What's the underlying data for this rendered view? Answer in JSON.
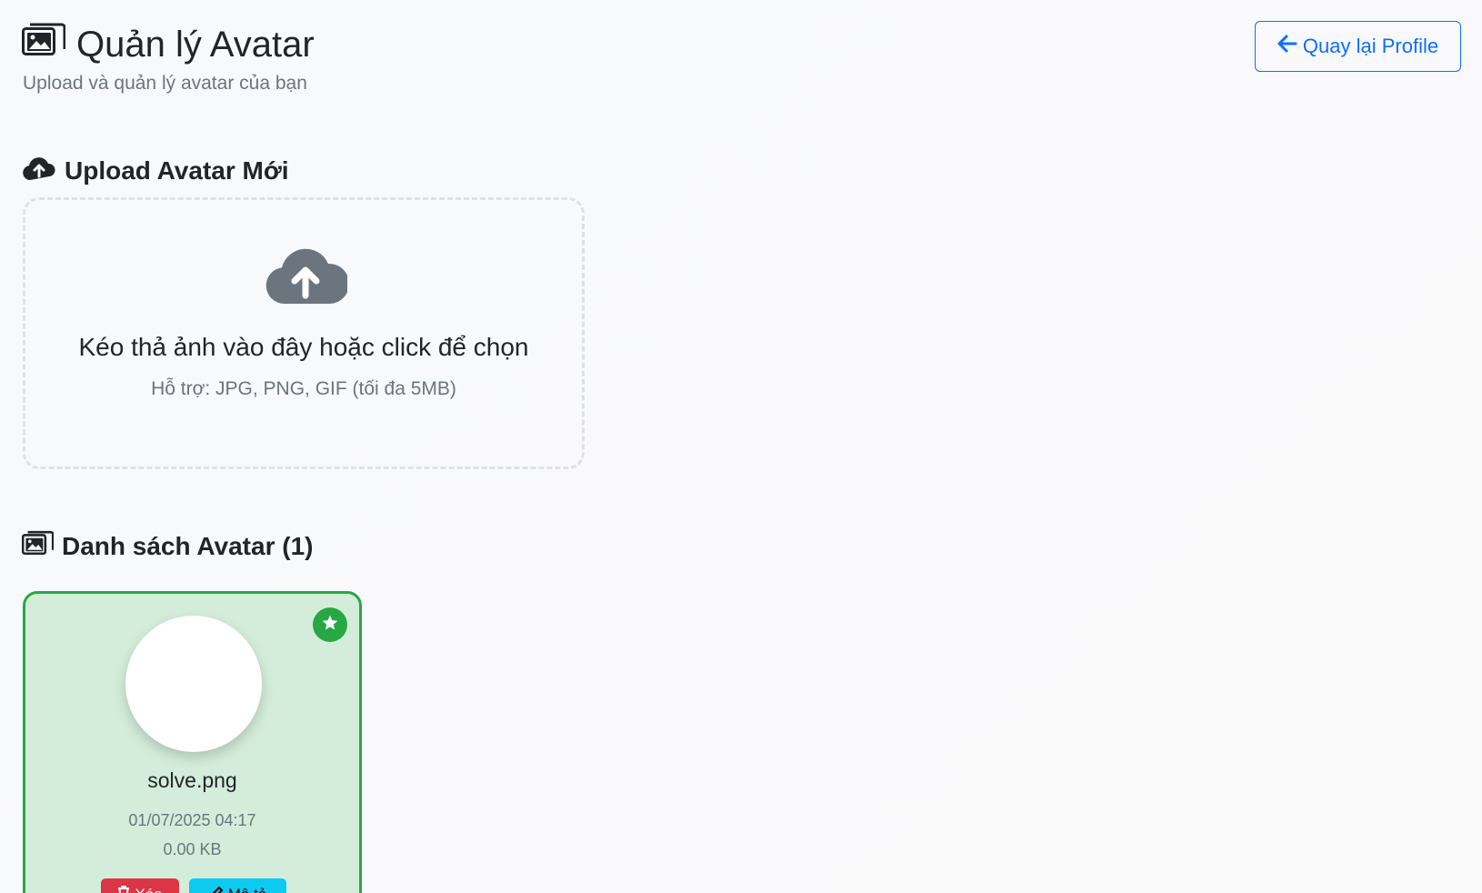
{
  "header": {
    "title": "Quản lý Avatar",
    "subtitle": "Upload và quản lý avatar của bạn",
    "back_button_label": "Quay lại Profile"
  },
  "upload": {
    "section_title": "Upload Avatar Mới",
    "dropzone_text": "Kéo thả ảnh vào đây hoặc click để chọn",
    "dropzone_hint": "Hỗ trợ: JPG, PNG, GIF (tối đa 5MB)"
  },
  "avatar_list": {
    "section_title": "Danh sách Avatar (1)",
    "items": [
      {
        "file_name": "solve.png",
        "uploaded_at": "01/07/2025 04:17",
        "size": "0.00 KB",
        "is_active": true,
        "delete_label": "Xóa",
        "describe_label": "Mô tả"
      }
    ]
  },
  "colors": {
    "primary": "#0d6efd",
    "success": "#28a745",
    "success_bg": "#d4edda",
    "danger": "#dc3545",
    "info": "#0dcaf0",
    "muted_text": "#6c757d",
    "dropzone_border": "#dee2e6",
    "upload_cloud": "#6c757d"
  },
  "icons": {
    "title_icon": "images-icon",
    "back_icon": "arrow-left-icon",
    "upload_section_icon": "cloud-upload-icon",
    "dropzone_icon": "cloud-upload-icon",
    "list_section_icon": "images-icon",
    "active_badge_icon": "star-icon",
    "delete_icon": "trash-icon",
    "describe_icon": "edit-icon"
  }
}
